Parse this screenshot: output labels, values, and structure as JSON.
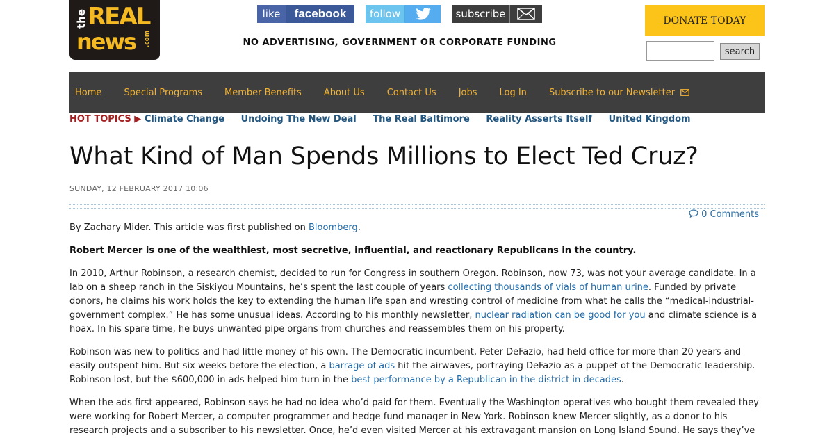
{
  "logo": {
    "the": "the",
    "real": "REAL",
    "news": "news",
    "com": ".com"
  },
  "social": {
    "facebook": {
      "label": "like",
      "brand": "facebook"
    },
    "twitter": {
      "label": "follow",
      "icon": "twitter-bird-icon"
    },
    "subscribe": {
      "label": "subscribe",
      "icon": "envelope-icon"
    }
  },
  "tagline": "NO ADVERTISING, GOVERNMENT OR CORPORATE FUNDING",
  "donate": "DONATE TODAY",
  "search": {
    "value": "",
    "button": "search"
  },
  "nav": {
    "items": [
      "Home",
      "Special Programs",
      "Member Benefits",
      "About Us",
      "Contact Us",
      "Jobs",
      "Log In",
      "Subscribe to our Newsletter"
    ]
  },
  "hot_topics": {
    "label": "HOT TOPICS ▶",
    "links": [
      "Climate Change",
      "Undoing The New Deal",
      "The Real Baltimore",
      "Reality Asserts Itself",
      "United Kingdom"
    ]
  },
  "article": {
    "title": "What Kind of Man Spends Millions to Elect Ted Cruz?",
    "date": "SUNDAY, 12 FEBRUARY 2017 10:06",
    "comments": "0 Comments",
    "byline_pre": "By Zachary Mider. This article was first published on ",
    "byline_link": "Bloomberg",
    "byline_post": ".",
    "lead": "Robert Mercer is one of the wealthiest, most secretive, influential, and reactionary Republicans in the country.",
    "p1": {
      "a": "In 2010, Arthur Robinson, a research chemist, decided to run for Congress in southern Oregon. Robinson, now 73, was not your average candidate. In a lab on a sheep ranch in the Siskiyou Mountains, he’s spent the last couple of years ",
      "link1": "collecting thousands of vials of human urine",
      "b": ". Funded by private donors, he claims his work holds the key to extending the human life span and wresting control of medicine from what he calls the “medical-industrial-government complex.” He has some unusual ideas. According to his monthly newsletter, ",
      "link2": "nuclear radiation can be good for you",
      "c": " and climate science is a hoax. In his spare time, he buys unwanted pipe organs from churches and reassembles them on his property."
    },
    "p2": {
      "a": "Robinson was new to politics and had little money of his own. The Democratic incumbent, Peter DeFazio, had held office for more than 20 years and easily outspent him. But six weeks before the election, a ",
      "link1": "barrage of ads",
      "b": " hit the airwaves, portraying DeFazio as a puppet of the Democratic leadership. Robinson lost, but the $600,000 in ads helped him turn in the ",
      "link2": "best performance by a Republican in the district in decades",
      "c": "."
    },
    "p3": "When the ads first appeared, Robinson says he had no idea who’d paid for them. Eventually the Washington operatives who bought them revealed they were working for Robert Mercer, a computer programmer and hedge fund manager in New York. Robinson knew Mercer slightly, as a donor to his research projects and a subscriber to his newsletter. Once, he’d even visited Mercer at his extravagant mansion on Long Island Sound. He says they’ve"
  },
  "colors": {
    "accent": "#fcc419",
    "nav_bg": "#3e3e3e",
    "nav_text": "#f2b233",
    "hot_label": "#a21d1d",
    "link": "#1f6aa8"
  }
}
